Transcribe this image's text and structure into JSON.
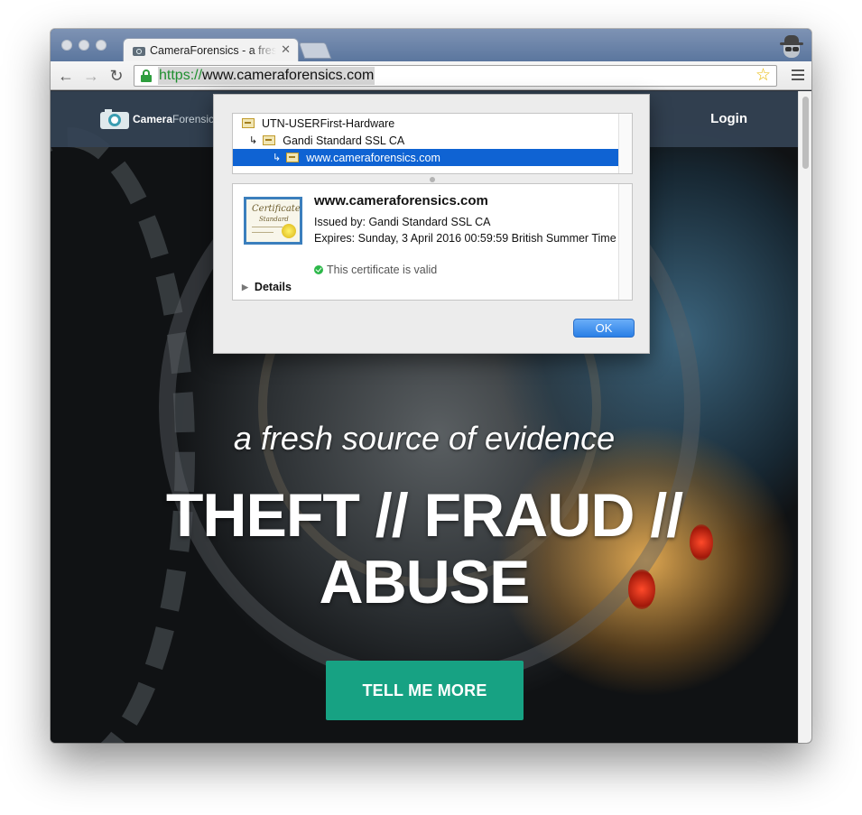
{
  "browser": {
    "tab_title": "CameraForensics - a fresh source of evidence",
    "tab_close": "✕",
    "url_scheme": "https://",
    "url_host": "www.cameraforensics.com",
    "star_glyph": "☆",
    "back_glyph": "←",
    "forward_glyph": "→",
    "reload_glyph": "↻"
  },
  "site": {
    "logo_bold": "Camera",
    "logo_light": "Forensics",
    "login": "Login",
    "tagline": "a fresh source of evidence",
    "headline": "THEFT // FRAUD // ABUSE",
    "cta": "TELL ME MORE"
  },
  "dialog": {
    "chain": [
      {
        "arrow": "",
        "label": "UTN-USERFirst-Hardware"
      },
      {
        "arrow": "↳",
        "label": "Gandi Standard SSL CA"
      },
      {
        "arrow": "↳",
        "label": "www.cameraforensics.com"
      }
    ],
    "cert_art_title": "Certificate",
    "cert_art_sub": "Standard",
    "title": "www.cameraforensics.com",
    "issued_by": "Issued by: Gandi Standard SSL CA",
    "expires": "Expires: Sunday, 3 April 2016 00:59:59 British Summer Time",
    "valid": "This certificate is valid",
    "details": "Details",
    "ok": "OK"
  },
  "colors": {
    "accent_cta": "#17a283",
    "selection": "#0f63d3",
    "valid_green": "#2db84a",
    "secure_green": "#1f8f2f"
  }
}
